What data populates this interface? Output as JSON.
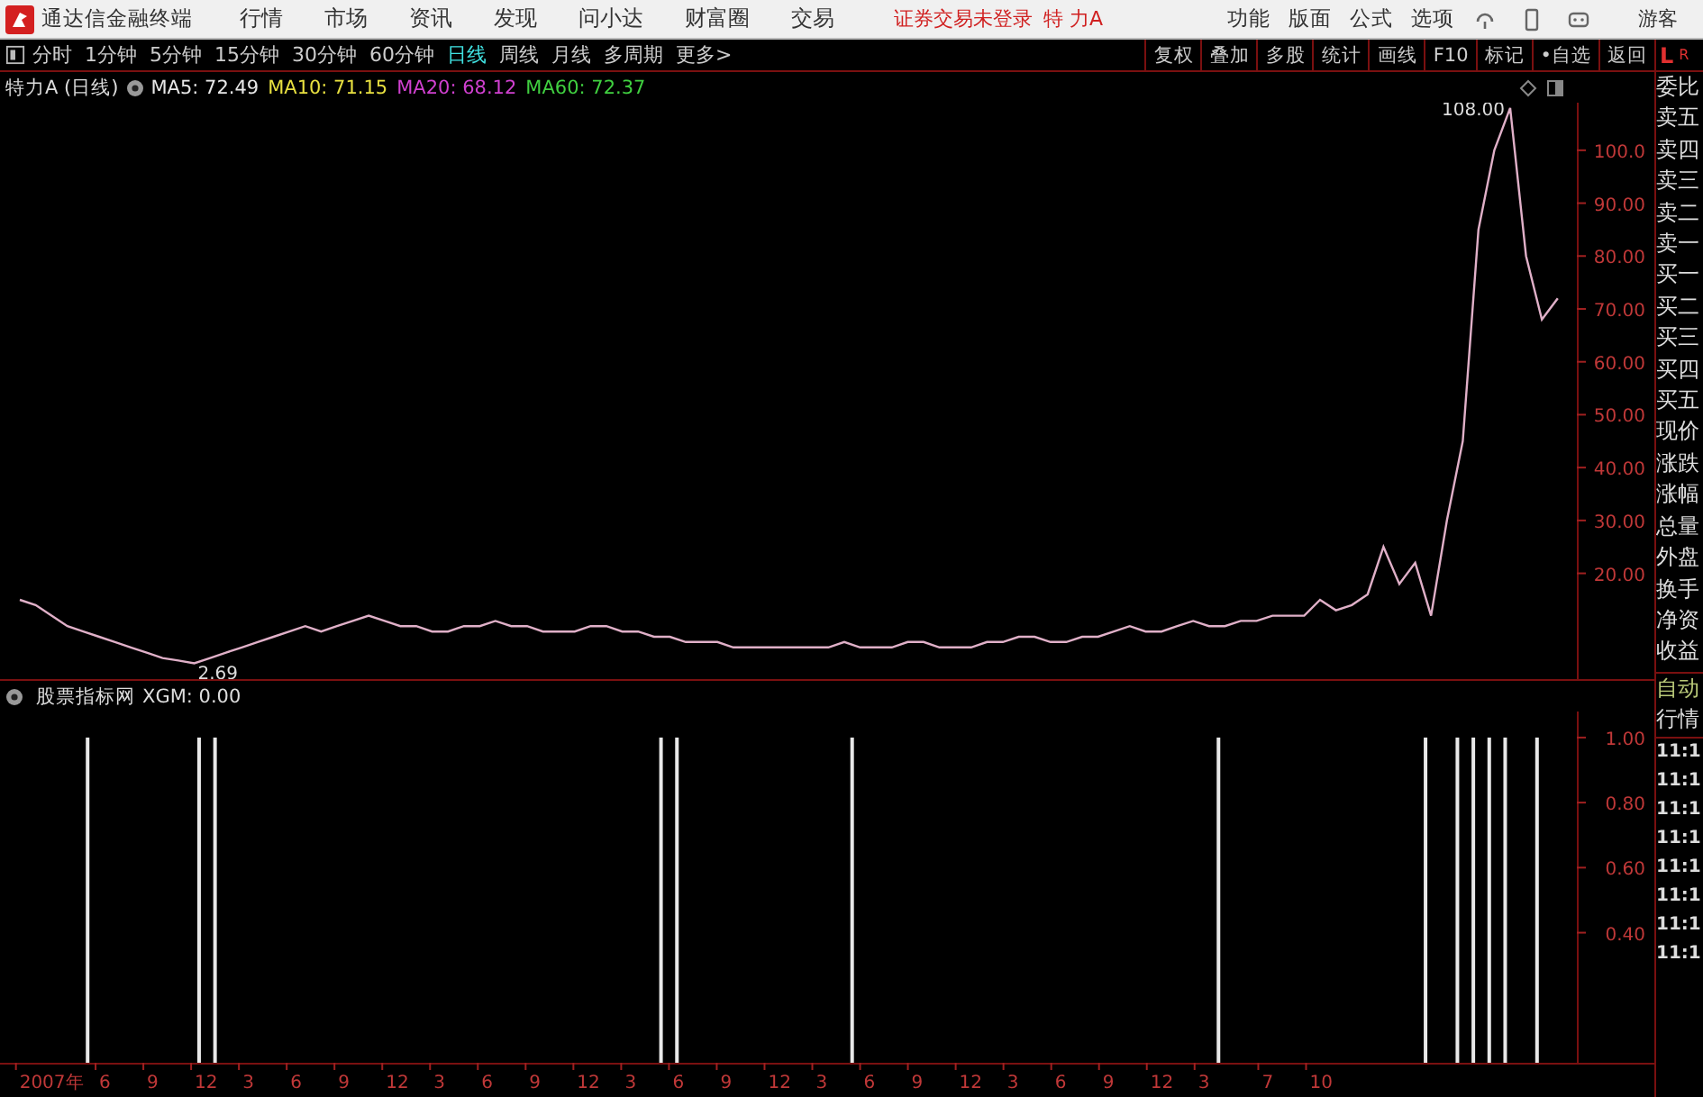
{
  "title_bar": {
    "app_name": "通达信金融终端",
    "menus": [
      "行情",
      "市场",
      "资讯",
      "发现",
      "问小达",
      "财富圈",
      "交易"
    ],
    "trade_status": "证券交易未登录",
    "stock_name": "特 力A",
    "right_menus": [
      "功能",
      "版面",
      "公式",
      "选项"
    ],
    "user": "游客"
  },
  "period_tabs": [
    {
      "label": "分时",
      "selected": false
    },
    {
      "label": "1分钟",
      "selected": false
    },
    {
      "label": "5分钟",
      "selected": false
    },
    {
      "label": "15分钟",
      "selected": false
    },
    {
      "label": "30分钟",
      "selected": false
    },
    {
      "label": "60分钟",
      "selected": false
    },
    {
      "label": "日线",
      "selected": true
    },
    {
      "label": "周线",
      "selected": false
    },
    {
      "label": "月线",
      "selected": false
    },
    {
      "label": "多周期",
      "selected": false
    },
    {
      "label": "更多>",
      "selected": false
    }
  ],
  "tool_buttons": [
    "复权",
    "叠加",
    "多股",
    "统计",
    "画线",
    "F10",
    "标记",
    "•自选",
    "返回"
  ],
  "panel_header": {
    "left": "L",
    "right": "R"
  },
  "main_chart": {
    "title": "特力A (日线)",
    "ma_labels": [
      {
        "text": "MA5: 72.49",
        "color": "#e8e8e8"
      },
      {
        "text": "MA10: 71.15",
        "color": "#e8e040"
      },
      {
        "text": "MA20: 68.12",
        "color": "#d040d0"
      },
      {
        "text": "MA60: 72.37",
        "color": "#40d040"
      }
    ],
    "chart_data": {
      "type": "line",
      "series": [
        {
          "color": "#e0b0c8",
          "values": [
            15,
            14,
            12,
            10,
            9,
            8,
            7,
            6,
            5,
            4,
            3.5,
            3,
            4,
            5,
            6,
            7,
            8,
            9,
            10,
            9,
            10,
            11,
            12,
            11,
            10,
            10,
            9,
            9,
            10,
            10,
            11,
            10,
            10,
            9,
            9,
            9,
            10,
            10,
            9,
            9,
            8,
            8,
            7,
            7,
            7,
            6,
            6,
            6,
            6,
            6,
            6,
            6,
            7,
            6,
            6,
            6,
            7,
            7,
            6,
            6,
            6,
            7,
            7,
            8,
            8,
            7,
            7,
            8,
            8,
            9,
            10,
            9,
            9,
            10,
            11,
            10,
            10,
            11,
            11,
            12,
            12,
            12,
            15,
            13,
            14,
            16,
            25,
            18,
            22,
            12,
            30,
            45,
            85,
            100,
            108,
            80,
            68,
            72
          ]
        }
      ],
      "ylim": [
        0,
        109
      ],
      "yticks": [
        {
          "value": 100,
          "label": "100.0"
        },
        {
          "value": 90,
          "label": "90.00"
        },
        {
          "value": 80,
          "label": "80.00"
        },
        {
          "value": 70,
          "label": "70.00"
        },
        {
          "value": 60,
          "label": "60.00"
        },
        {
          "value": 50,
          "label": "50.00"
        },
        {
          "value": 40,
          "label": "40.00"
        },
        {
          "value": 30,
          "label": "30.00"
        },
        {
          "value": 20,
          "label": "20.00"
        }
      ],
      "annotations": [
        "108.00",
        "2.69"
      ]
    }
  },
  "indicator": {
    "title": "股票指标网",
    "reading": "XGM: 0.00",
    "chart_data": {
      "type": "bar",
      "categories": [
        null,
        "2007年",
        null,
        null,
        null,
        null,
        "6",
        null,
        null,
        "9",
        null,
        null,
        "12",
        null,
        null,
        "3",
        null,
        null,
        "6",
        null,
        null,
        "9",
        null,
        null,
        "12",
        null,
        null,
        "3",
        null,
        null,
        "6",
        null,
        null,
        "9",
        null,
        null,
        "12",
        null,
        null,
        "3",
        null,
        null,
        "6",
        null,
        null,
        "9",
        null,
        null,
        "12",
        null,
        null,
        "3",
        null,
        null,
        "6",
        null,
        null,
        "9",
        null,
        null,
        "12",
        null,
        null,
        "3",
        null,
        null,
        "6",
        null,
        null,
        "9",
        null,
        null,
        "12",
        null,
        null,
        "3",
        null,
        null,
        null,
        "7",
        null,
        null,
        "10",
        null,
        null,
        null,
        null,
        null,
        null,
        null,
        null,
        null,
        null,
        null,
        null,
        null,
        null,
        null,
        null
      ],
      "values": [
        0,
        0,
        0,
        0,
        0,
        1,
        0,
        0,
        0,
        0,
        0,
        0,
        1,
        1,
        0,
        0,
        0,
        0,
        0,
        0,
        0,
        0,
        0,
        0,
        0,
        0,
        0,
        0,
        0,
        0,
        0,
        0,
        0,
        0,
        0,
        0,
        0,
        0,
        0,
        0,
        0,
        1,
        1,
        0,
        0,
        0,
        0,
        0,
        0,
        0,
        0,
        0,
        0,
        1,
        0,
        0,
        0,
        0,
        0,
        0,
        0,
        0,
        0,
        0,
        0,
        0,
        0,
        0,
        0,
        0,
        0,
        0,
        0,
        0,
        0,
        0,
        1,
        0,
        0,
        0,
        0,
        0,
        0,
        0,
        0,
        0,
        0,
        0,
        0,
        1,
        0,
        1,
        1,
        1,
        1,
        0,
        1,
        0,
        0
      ],
      "ylim": [
        0,
        1.08
      ],
      "yticks": [
        {
          "value": 1,
          "label": "1.00"
        },
        {
          "value": 0.8,
          "label": "0.80"
        },
        {
          "value": 0.6,
          "label": "0.60"
        },
        {
          "value": 0.4,
          "label": "0.40"
        }
      ]
    }
  },
  "quote_labels": [
    "委比",
    "卖五",
    "卖四",
    "卖三",
    "卖二",
    "卖一",
    "买一",
    "买二",
    "买三",
    "买四",
    "买五",
    "现价",
    "涨跌",
    "涨幅",
    "总量",
    "外盘",
    "换手",
    "净资",
    "收益"
  ],
  "mode_labels": [
    {
      "text": "自动",
      "color": "#b8c878"
    },
    {
      "text": "行情"
    }
  ],
  "tick_times": [
    "11:1",
    "11:1",
    "11:1",
    "11:1",
    "11:1",
    "11:1",
    "11:1",
    "11:1"
  ]
}
